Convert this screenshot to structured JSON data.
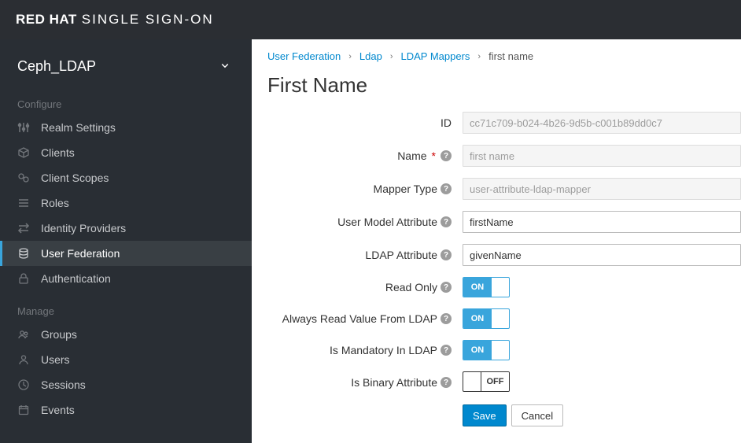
{
  "brand": {
    "left": "RED HAT",
    "right": "SINGLE SIGN-ON"
  },
  "realm": {
    "name": "Ceph_LDAP"
  },
  "sidebar": {
    "configure_label": "Configure",
    "manage_label": "Manage",
    "configure": {
      "realm_settings": "Realm Settings",
      "clients": "Clients",
      "client_scopes": "Client Scopes",
      "roles": "Roles",
      "identity_providers": "Identity Providers",
      "user_federation": "User Federation",
      "authentication": "Authentication"
    },
    "manage": {
      "groups": "Groups",
      "users": "Users",
      "sessions": "Sessions",
      "events": "Events"
    }
  },
  "breadcrumb": {
    "user_federation": "User Federation",
    "ldap": "Ldap",
    "ldap_mappers": "LDAP Mappers",
    "current": "first name"
  },
  "page": {
    "title": "First Name"
  },
  "form": {
    "labels": {
      "id": "ID",
      "name": "Name",
      "mapper_type": "Mapper Type",
      "user_model_attribute": "User Model Attribute",
      "ldap_attribute": "LDAP Attribute",
      "read_only": "Read Only",
      "always_read": "Always Read Value From LDAP",
      "is_mandatory": "Is Mandatory In LDAP",
      "is_binary": "Is Binary Attribute"
    },
    "values": {
      "id": "cc71c709-b024-4b26-9d5b-c001b89dd0c7",
      "name": "first name",
      "mapper_type": "user-attribute-ldap-mapper",
      "user_model_attribute": "firstName",
      "ldap_attribute": "givenName",
      "read_only": true,
      "always_read": true,
      "is_mandatory": true,
      "is_binary": false
    },
    "toggle": {
      "on": "ON",
      "off": "OFF"
    },
    "buttons": {
      "save": "Save",
      "cancel": "Cancel"
    }
  }
}
